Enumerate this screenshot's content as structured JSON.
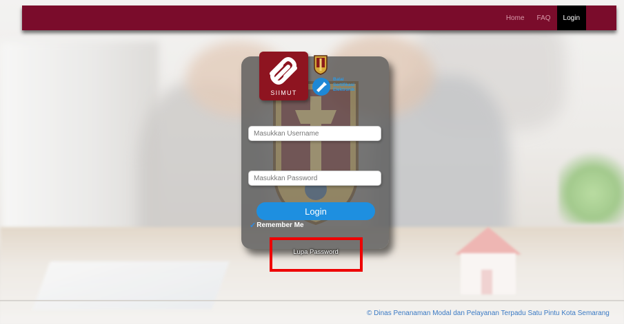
{
  "navbar": {
    "links": [
      {
        "label": "Home",
        "active": false
      },
      {
        "label": "FAQ",
        "active": false
      },
      {
        "label": "Login",
        "active": true
      }
    ],
    "color": "#7a0c2b"
  },
  "logos": {
    "siimut_label": "SIIMUT",
    "bse_text": [
      "Balai",
      "Sertifikasi",
      "Elektronik"
    ]
  },
  "login_form": {
    "username_placeholder": "Masukkan Username",
    "password_placeholder": "Masukkan Password",
    "login_button": "Login",
    "remember_label": "Remember Me",
    "remember_checked": true,
    "forgot_link": "Lupa Password"
  },
  "footer": {
    "text": "© Dinas Penanaman Modal dan Pelayanan Terpadu Satu Pintu Kota Semarang"
  },
  "colors": {
    "button": "#1e8fe0",
    "highlight": "#ee0000",
    "footer_text": "#3a79c4"
  }
}
